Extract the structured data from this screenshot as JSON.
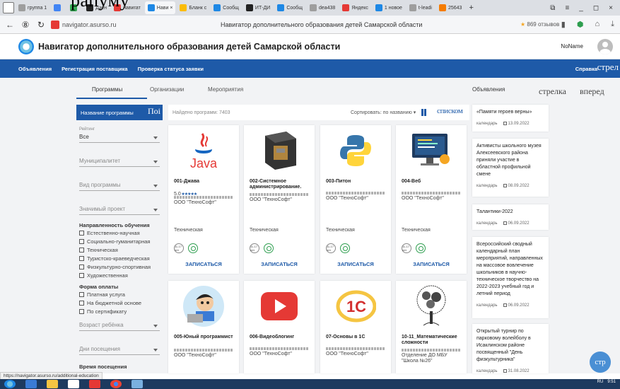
{
  "overlay": {
    "top_text": "рапуму"
  },
  "browser": {
    "tabs": [
      {
        "label": "группа 1",
        "color": "#9e9e9e"
      },
      {
        "label": "",
        "color": "#4285f4"
      },
      {
        "label": "",
        "color": "#34a853"
      },
      {
        "label": "Дзен",
        "color": "#222222"
      },
      {
        "label": "навигат",
        "color": "#e53935"
      },
      {
        "label": "Нави ×",
        "color": "#1e88e5",
        "active": true
      },
      {
        "label": "Бланк с",
        "color": "#fbbc05"
      },
      {
        "label": "Сообщ",
        "color": "#1e88e5"
      },
      {
        "label": "ИТ-ДИ",
        "color": "#222222"
      },
      {
        "label": "Сообщ",
        "color": "#1e88e5"
      },
      {
        "label": "dea438",
        "color": "#9e9e9e"
      },
      {
        "label": "Яндекс",
        "color": "#e53935"
      },
      {
        "label": "1 новое",
        "color": "#1e88e5"
      },
      {
        "label": "t-leadi",
        "color": "#9e9e9e"
      },
      {
        "label": "25643",
        "color": "#f57c00"
      }
    ],
    "url": "navigator.asurso.ru",
    "page_title": "Навигатор дополнительного образования детей Самарской области",
    "reviews": "869 отзывов"
  },
  "header": {
    "site_title": "Навигатор дополнительного образования детей Самарской области",
    "user_name": "NoName"
  },
  "nav": {
    "items": [
      "Объявления",
      "Регистрация поставщика",
      "Проверка статуса заявки"
    ],
    "help": "Справка",
    "help_glitch": "стрел"
  },
  "tabs": {
    "items": [
      "Программы",
      "Организации",
      "Мероприятия"
    ],
    "announcements_title": "Объявления",
    "strelka": "стрелка",
    "vpered": "вперед"
  },
  "filters": {
    "search_button": "Название программы",
    "search_glitch": "Поі",
    "rating_label": "Рейтинг",
    "rating_value": "Все",
    "municipality": "Муниципалитет",
    "program_type": "Вид программы",
    "significant_project": "Значимый проект",
    "direction_title": "Направленность обучения",
    "directions": [
      "Естественно-научная",
      "Социально-гуманитарная",
      "Техническая",
      "Туристско-краеведческая",
      "Физкультурно-спортивная",
      "Художественная"
    ],
    "payment_title": "Форма оплаты",
    "payments": [
      "Платная услуга",
      "На бюджетной основе",
      "По сертификату"
    ],
    "child_age": "Возраст ребёнка",
    "visit_days": "Дни посещения",
    "visit_time": "Время посещения"
  },
  "results": {
    "found": "Найдено программ: 7403",
    "sort": "Сортировать: по названию",
    "spisok": "списком"
  },
  "cards": [
    {
      "title": "001-Джава",
      "rating": "5.0",
      "org": "ООО \"ТехноСофт\"",
      "dir": "Техническая",
      "age": "11-17 лет",
      "enroll": "ЗАПИСАТЬСЯ",
      "icon": "java-logo"
    },
    {
      "title": "002-Системное администрирование.",
      "org": "ООО \"ТехноСофт\"",
      "dir": "Техническая",
      "age": "11-17 лет",
      "enroll": "ЗАПИСАТЬСЯ",
      "icon": "server-case"
    },
    {
      "title": "003-Питон",
      "org": "ООО \"ТехноСофт\"",
      "dir": "Техническая",
      "age": "11-17 лет",
      "enroll": "ЗАПИСАТЬСЯ",
      "icon": "python-logo"
    },
    {
      "title": "004-Веб",
      "org": "ООО \"ТехноСофт\"",
      "dir": "Техническая",
      "age": "11-17 лет",
      "enroll": "ЗАПИСАТЬСЯ",
      "icon": "web-monitor"
    },
    {
      "title": "005-Юный программист",
      "org": "ООО \"ТехноСофт\"",
      "icon": "boy-laptop"
    },
    {
      "title": "006-Видеоблогинг",
      "org": "ООО \"ТехноСофт\"",
      "icon": "youtube-logo"
    },
    {
      "title": "07-Основы в 1С",
      "org": "ООО \"ТехноСофт\"",
      "icon": "1c-logo"
    },
    {
      "title": "10-11_Математические сложности",
      "org": "Отделение ДО МБУ \"Школа №26\"",
      "icon": "math-tree"
    }
  ],
  "announcements": [
    {
      "title": "«Памяти героев верны»",
      "tag": "календарь",
      "date": "13.09.2022"
    },
    {
      "title": "Активисты школьного музея Алексеевского района приняли участие в областной профильной смене",
      "tag": "календарь",
      "date": "08.09.2022"
    },
    {
      "title": "Талантики-2022",
      "tag": "календарь",
      "date": "06.09.2022"
    },
    {
      "title": "Всероссийский сводный календарный план мероприятий, направленных на массовое вовлечение школьников в научно-техническое творчество на 2022-2023 учебный год и летний период",
      "tag": "календарь",
      "date": "06.09.2022"
    },
    {
      "title": "Открытый турнир по парковому волейболу в Исаклинском районе посвященный \"День физкультурника\"",
      "tag": "календарь",
      "date": "31.08.2022"
    }
  ],
  "fab": "стр",
  "status_url": "https://navigator.asurso.ru/additional-education",
  "taskbar": {
    "lang": "RU",
    "time": "9:51"
  }
}
